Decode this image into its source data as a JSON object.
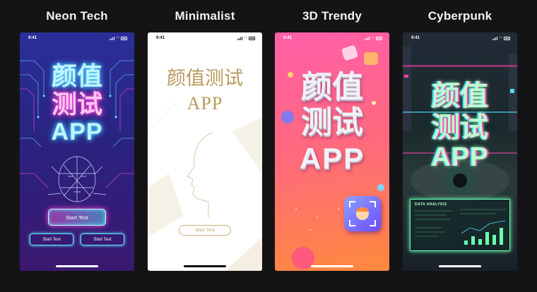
{
  "variants": [
    {
      "title": "Neon Tech",
      "time": "9:41",
      "headline": [
        "颜值",
        "测试",
        "APP"
      ],
      "primary_button": "Start Test",
      "secondary_buttons": [
        "Start Test",
        "Start Test"
      ],
      "colors": {
        "bg_top": "#2a2a8a",
        "bg_bottom": "#3a1a6e",
        "cyan": "#5ee6ff",
        "magenta": "#ff4fd8"
      }
    },
    {
      "title": "Minimalist",
      "time": "9:41",
      "headline": [
        "颜值测试",
        "APP"
      ],
      "primary_button": "Start Test",
      "colors": {
        "bg": "#ffffff",
        "gold": "#b89a5c"
      }
    },
    {
      "title": "3D Trendy",
      "time": "9:41",
      "headline": [
        "颜值",
        "测试",
        "APP"
      ],
      "colors": {
        "bg_top": "#ff5fa8",
        "bg_bottom": "#ff8a3d",
        "chrome": "#e8e8f0"
      }
    },
    {
      "title": "Cyberpunk",
      "time": "9:41",
      "headline": [
        "颜值",
        "测试",
        "APP"
      ],
      "panel_title": "DATA ANALYSIS",
      "colors": {
        "bg": "#1a2430",
        "green": "#9cffbf",
        "accent": "#ff3fa8"
      }
    }
  ]
}
